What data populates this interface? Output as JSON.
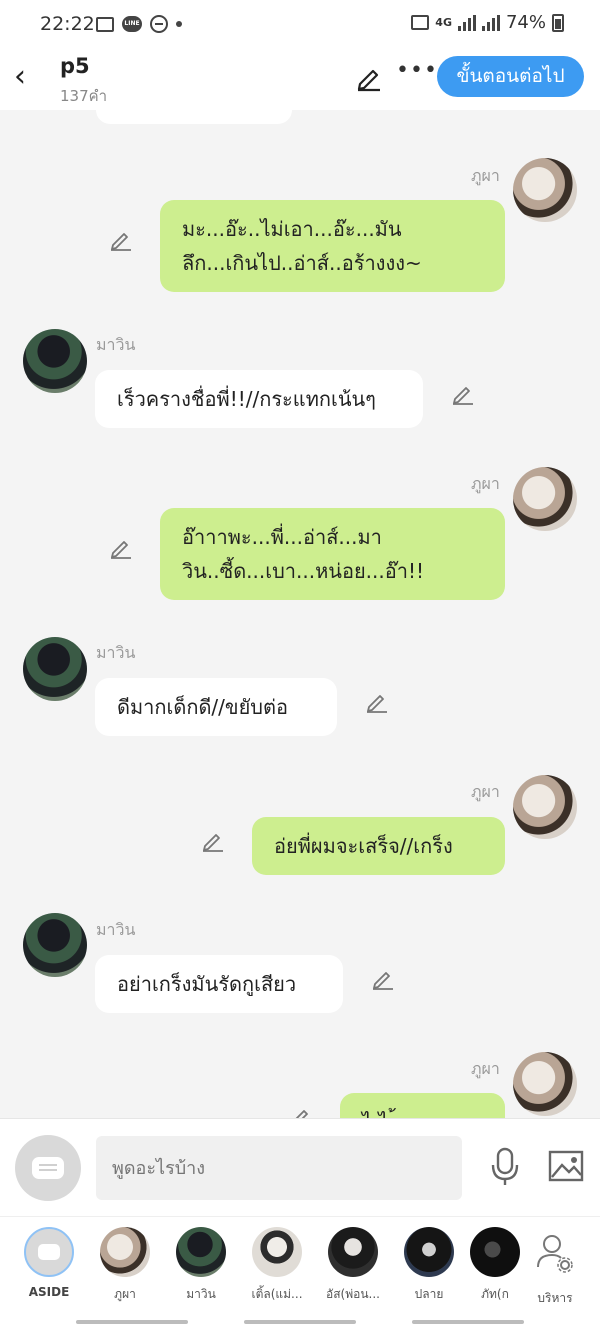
{
  "status_bar": {
    "time": "22:22",
    "network": "4G",
    "battery": "74%"
  },
  "header": {
    "title": "p5",
    "word_count": "137คำ",
    "next_button": "ขั้นตอนต่อไป"
  },
  "messages": [
    {
      "side": "right",
      "name": "ภูผา",
      "lines": [
        "มะ...อ๊ะ..ไม่เอา...อ๊ะ...มัน",
        "ลึก...เกินไป..อ่าส์..อร้างงง~"
      ]
    },
    {
      "side": "left",
      "name": "มาวิน",
      "lines": [
        "เร็วครางชื่อพี่!!//กระแทกเน้นๆ"
      ]
    },
    {
      "side": "right",
      "name": "ภูผา",
      "lines": [
        "อ๊าาาพะ...พี่...อ่าส์...มา",
        "วิน..ซี้ด...เบา...หน่อย...อ๊า!!"
      ]
    },
    {
      "side": "left",
      "name": "มาวิน",
      "lines": [
        "ดีมากเด็กดี//ขยับต่อ"
      ]
    },
    {
      "side": "right",
      "name": "ภูผา",
      "lines": [
        "อ่ยพี่ผมจะเสร็จ//เกร็ง"
      ]
    },
    {
      "side": "left",
      "name": "มาวิน",
      "lines": [
        "อย่าเกร็งมันรัดกูเสียว"
      ]
    },
    {
      "side": "right",
      "name": "ภูผา",
      "lines": [
        "ไ ไ ้"
      ]
    }
  ],
  "composer": {
    "placeholder": "พูดอะไรบ้าง"
  },
  "characters": [
    {
      "label": "ASIDE"
    },
    {
      "label": "ภูผา"
    },
    {
      "label": "มาวิน"
    },
    {
      "label": "เติ้ล(แม่..."
    },
    {
      "label": "อัส(พ่อน..."
    },
    {
      "label": "ปลาย"
    },
    {
      "label": "ภัท(ก"
    },
    {
      "label": "บริหาร"
    }
  ],
  "colors": {
    "accent": "#3d9bf2",
    "my_bubble": "#cdee8f",
    "their_bubble": "#ffffff"
  }
}
